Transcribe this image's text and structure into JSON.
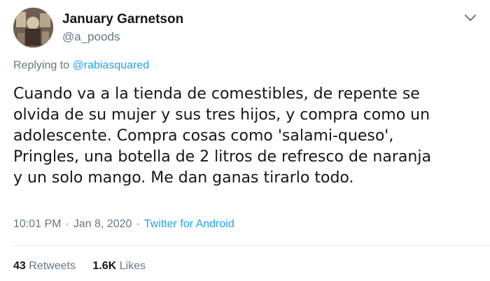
{
  "author": {
    "display_name": "January Garnetson",
    "handle": "@a_poods"
  },
  "reply": {
    "prefix": "Replying to",
    "mention": "@rabiasquared"
  },
  "tweet": {
    "text": "Cuando va a la tienda de comestibles, de repente se\nolvida de su mujer y sus tres hijos, y compra como un\nadolescente. Compra cosas como 'salami-queso',\nPringles, una botella de 2 litros de refresco de naranja\ny un solo mango. Me dan ganas tirarlo todo."
  },
  "meta": {
    "time": "10:01 PM",
    "separator": "·",
    "date": "Jan 8, 2020",
    "source": "Twitter for Android"
  },
  "stats": {
    "retweets_count": "43",
    "retweets_label": "Retweets",
    "likes_count": "1.6K",
    "likes_label": "Likes"
  },
  "icons": {
    "caret": "chevron-down-icon"
  },
  "colors": {
    "link": "#1da1f2",
    "secondary_text": "#657786",
    "primary_text": "#14171a",
    "divider": "#e1e8ed"
  }
}
